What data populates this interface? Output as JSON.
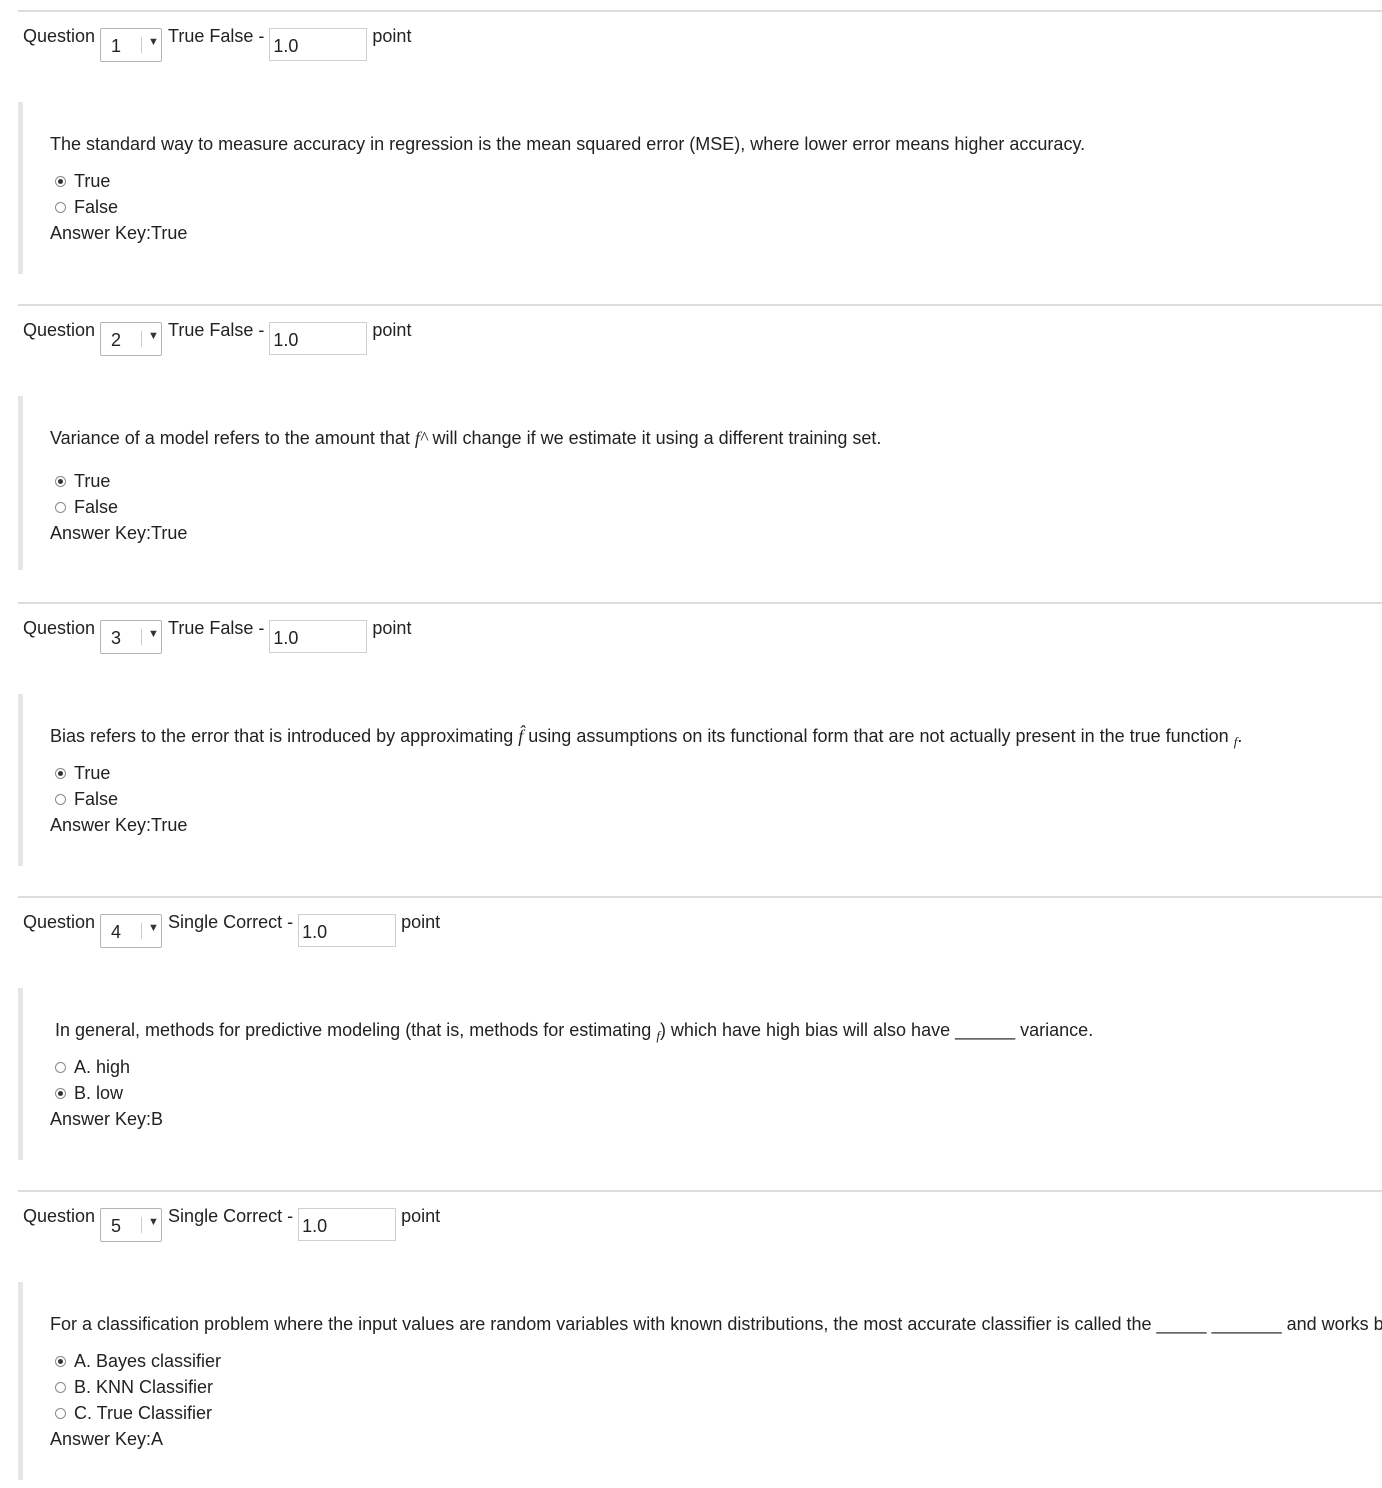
{
  "questions": [
    {
      "label": "Question",
      "number": "1",
      "type": "True False -",
      "points": "1.0",
      "unit": "point",
      "text": "The standard way to measure accuracy in regression is the mean squared error (MSE), where lower error means higher accuracy.",
      "options": [
        {
          "label": "True",
          "checked": true
        },
        {
          "label": "False",
          "checked": false
        }
      ],
      "answer_key": "Answer Key:True"
    },
    {
      "label": "Question",
      "number": "2",
      "type": "True False -",
      "points": "1.0",
      "unit": "point",
      "text_before": "Variance of a model refers to the amount that",
      "math": "f^",
      "text_after": "will change if we estimate it using a different training set.",
      "options": [
        {
          "label": "True",
          "checked": true
        },
        {
          "label": "False",
          "checked": false
        }
      ],
      "answer_key": "Answer Key:True"
    },
    {
      "label": "Question",
      "number": "3",
      "type": "True False -",
      "points": "1.0",
      "unit": "point",
      "text_before": "Bias refers to the error that is introduced by approximating",
      "math": "f̂",
      "text_middle": "using assumptions on its functional form that are not actually present in the true function",
      "math2": "f",
      "text_after": ".",
      "options": [
        {
          "label": "True",
          "checked": true
        },
        {
          "label": "False",
          "checked": false
        }
      ],
      "answer_key": "Answer Key:True"
    },
    {
      "label": "Question",
      "number": "4",
      "type": "Single Correct -",
      "points": "1.0",
      "unit": "point",
      "text_before": "In general, methods for predictive modeling (that is, methods for estimating",
      "math": "f",
      "text_after": ") which have high bias will also have ______ variance.",
      "options": [
        {
          "label": "A. high",
          "checked": false
        },
        {
          "label": "B. low",
          "checked": true
        }
      ],
      "answer_key": "Answer Key:B"
    },
    {
      "label": "Question",
      "number": "5",
      "type": "Single Correct -",
      "points": "1.0",
      "unit": "point",
      "text": "For a classification problem where the input values are random variables with known distributions, the most accurate classifier is called the _____ _______ and works b",
      "options": [
        {
          "label": "A. Bayes classifier",
          "checked": true
        },
        {
          "label": "B. KNN Classifier",
          "checked": false
        },
        {
          "label": "C. True Classifier",
          "checked": false
        }
      ],
      "answer_key": "Answer Key:A"
    }
  ]
}
